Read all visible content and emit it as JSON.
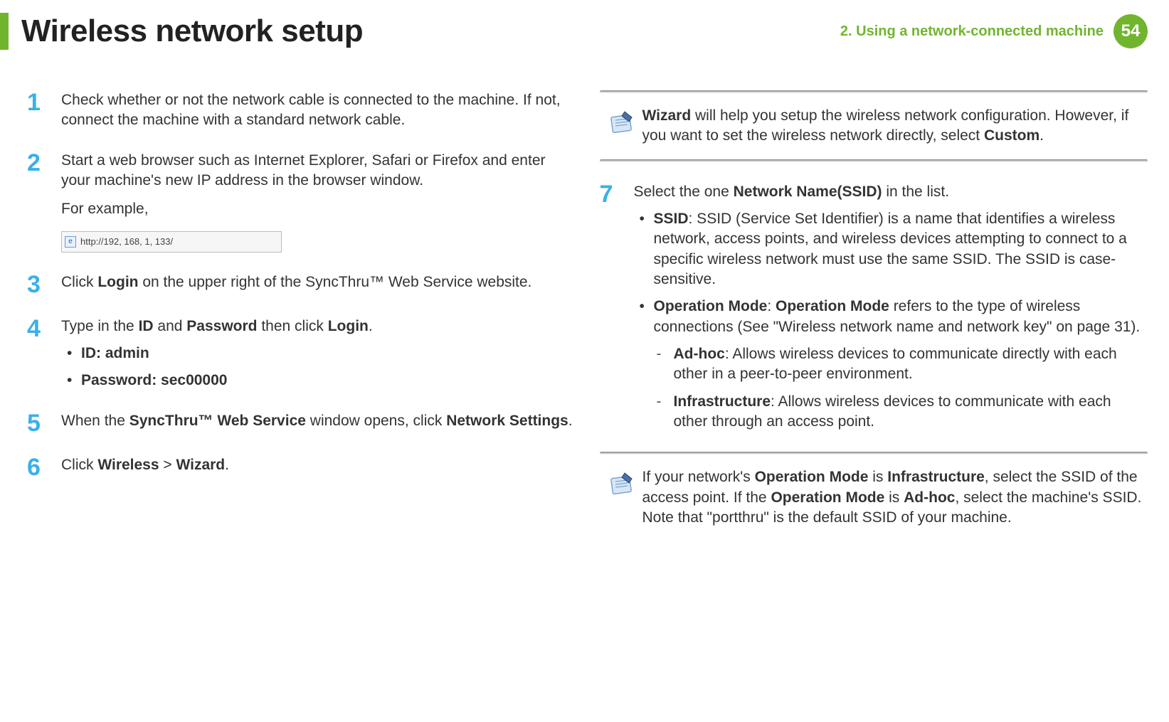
{
  "header": {
    "title": "Wireless network setup",
    "chapter": "2.  Using a network-connected machine",
    "page": "54"
  },
  "left": {
    "step1": "Check whether or not the network cable is connected to the machine. If not, connect the machine with a standard network cable.",
    "step2_a": "Start a web browser such as Internet Explorer, Safari or Firefox and enter your machine's new IP address in the browser window.",
    "step2_b": "For example,",
    "url": "http://192, 168, 1, 133/",
    "step3_a": "Click ",
    "step3_b": "Login",
    "step3_c": " on the upper right of the SyncThru™ Web Service website.",
    "step4_a": "Type in the ",
    "step4_b": "ID",
    "step4_c": " and ",
    "step4_d": "Password",
    "step4_e": " then click ",
    "step4_f": "Login",
    "step4_g": ".",
    "step4_id": "ID: admin",
    "step4_pw": "Password: sec00000",
    "step5_a": "When the ",
    "step5_b": "SyncThru™ Web Service",
    "step5_c": " window opens, click ",
    "step5_d": "Network Settings",
    "step5_e": ".",
    "step6_a": "Click ",
    "step6_b": "Wireless",
    "step6_c": " > ",
    "step6_d": "Wizard",
    "step6_e": "."
  },
  "right": {
    "note1_a": "Wizard",
    "note1_b": " will help you setup the wireless network configuration. However, if you want to set the wireless network directly, select ",
    "note1_c": "Custom",
    "note1_d": ".",
    "step7_a": "Select the one ",
    "step7_b": "Network Name(SSID)",
    "step7_c": " in the list.",
    "ssid_a": "SSID",
    "ssid_b": ": SSID (Service Set Identifier) is a name that identifies a wireless network, access points, and wireless devices attempting to connect to a specific wireless network must use the same SSID. The SSID is case-sensitive.",
    "opmode_a": "Operation Mode",
    "opmode_b": ": ",
    "opmode_c": "Operation Mode",
    "opmode_d": " refers to the type of wireless connections (See \"Wireless network name and network key\" on page 31).",
    "adhoc_a": "Ad-hoc",
    "adhoc_b": ": Allows wireless devices to communicate directly with each other in a peer-to-peer environment.",
    "infra_a": "Infrastructure",
    "infra_b": ": Allows wireless devices to communicate with each other through an access point.",
    "note2_a": "If your network's ",
    "note2_b": "Operation Mode",
    "note2_c": " is ",
    "note2_d": "Infrastructure",
    "note2_e": ", select the SSID of the access point. If the ",
    "note2_f": "Operation Mode",
    "note2_g": " is ",
    "note2_h": "Ad-hoc",
    "note2_i": ", select the machine's SSID. Note that \"portthru\" is the default SSID of your machine."
  }
}
